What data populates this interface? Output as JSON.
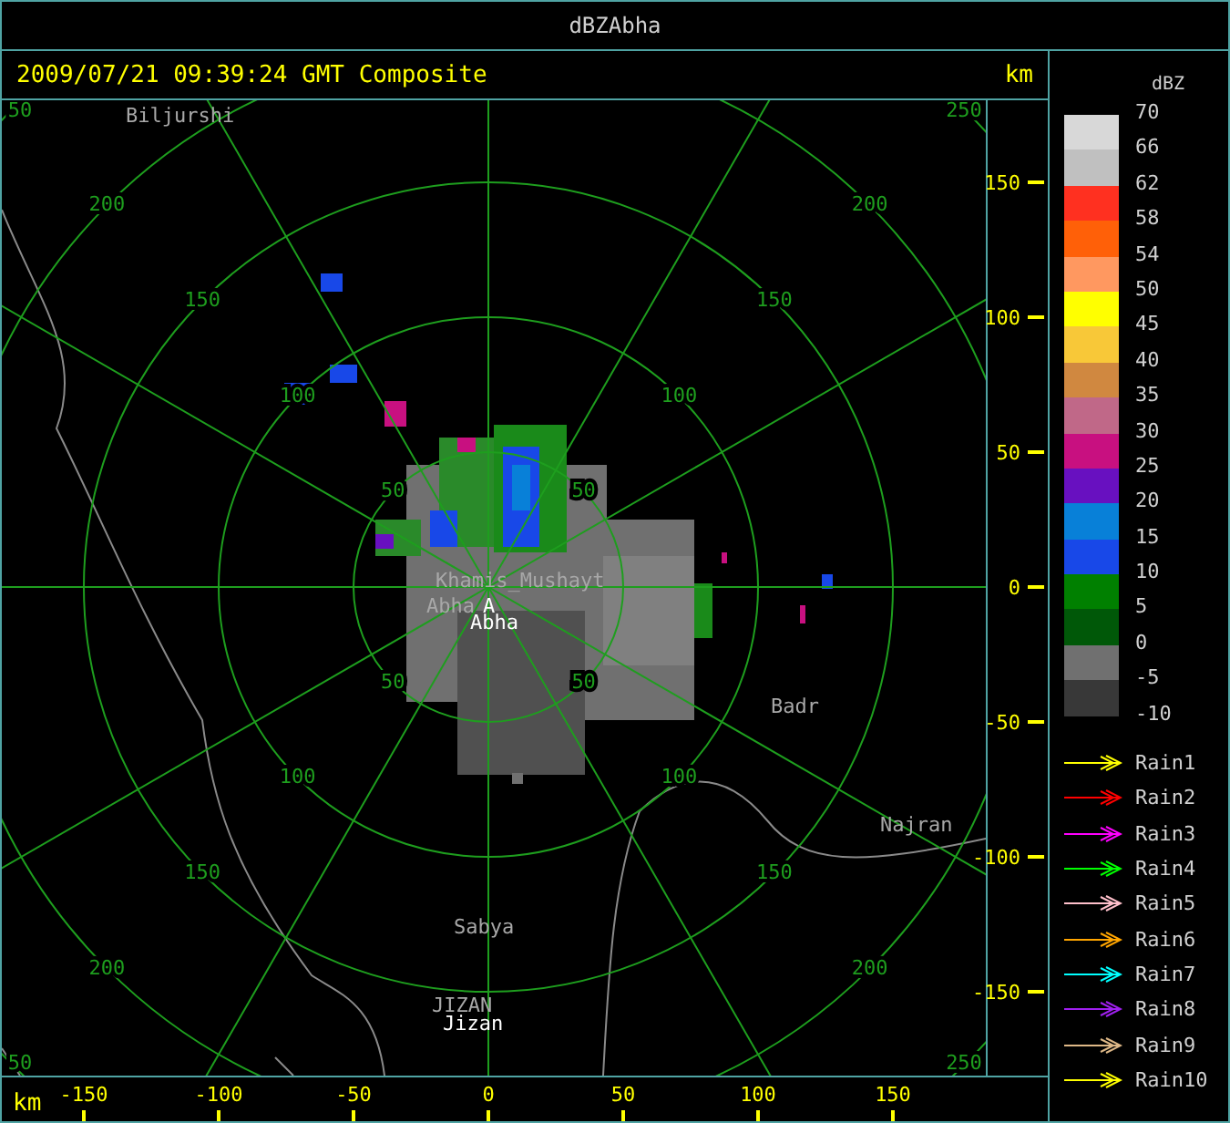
{
  "window": {
    "title": "dBZAbha"
  },
  "header": {
    "timestamp": "2009/07/21 09:39:24 GMT Composite",
    "unit": "km"
  },
  "map": {
    "rings": [
      {
        "labels": [
          "50",
          "50",
          "50",
          "50"
        ]
      },
      {
        "labels": [
          "100",
          "100",
          "100",
          "100"
        ]
      },
      {
        "labels": [
          "150",
          "150",
          "150",
          "150"
        ]
      },
      {
        "labels": [
          "200",
          "200",
          "200",
          "200"
        ]
      },
      {
        "labels": [
          "50",
          "250",
          "50",
          "250"
        ]
      }
    ],
    "places": [
      {
        "name": "Biljurshi",
        "kind": "town"
      },
      {
        "name": "Khamis_Mushayt",
        "kind": "town"
      },
      {
        "name": "Abha",
        "kind": "town"
      },
      {
        "name": "A",
        "kind": "radar"
      },
      {
        "name": "Abha",
        "kind": "radar"
      },
      {
        "name": "Badr",
        "kind": "town"
      },
      {
        "name": "Najran",
        "kind": "town"
      },
      {
        "name": "Sabya",
        "kind": "town"
      },
      {
        "name": "JIZAN",
        "kind": "town"
      },
      {
        "name": "Jizan",
        "kind": "radar"
      }
    ]
  },
  "y_axis": {
    "ticks": [
      "150",
      "100",
      "50",
      "0",
      "-50",
      "-100",
      "-150"
    ]
  },
  "x_axis": {
    "unit": "km",
    "ticks": [
      "-150",
      "-100",
      "-50",
      "0",
      "50",
      "100",
      "150"
    ]
  },
  "legend": {
    "title": "dBZ",
    "labels": [
      "70",
      "66",
      "62",
      "58",
      "54",
      "50",
      "45",
      "40",
      "35",
      "30",
      "25",
      "20",
      "15",
      "10",
      "5",
      "0",
      "-5",
      "-10"
    ],
    "bins": [
      {
        "color": "#d8d8d8"
      },
      {
        "color": "#c0c0c0"
      },
      {
        "color": "#ff3020"
      },
      {
        "color": "#ff6008"
      },
      {
        "color": "#ff9860"
      },
      {
        "color": "#ffff00"
      },
      {
        "color": "#f8c838"
      },
      {
        "color": "#d08840"
      },
      {
        "color": "#c06888"
      },
      {
        "color": "#c81080"
      },
      {
        "color": "#6810c0"
      },
      {
        "color": "#0880d8"
      },
      {
        "color": "#1848e8"
      },
      {
        "color": "#008000"
      },
      {
        "color": "#005808"
      },
      {
        "color": "#707070"
      },
      {
        "color": "#383838"
      }
    ],
    "tracks": [
      {
        "label": "Rain1",
        "color": "#ffff00"
      },
      {
        "label": "Rain2",
        "color": "#ff0000"
      },
      {
        "label": "Rain3",
        "color": "#ff00ff"
      },
      {
        "label": "Rain4",
        "color": "#00ff00"
      },
      {
        "label": "Rain5",
        "color": "#ffc0cb"
      },
      {
        "label": "Rain6",
        "color": "#ffa500"
      },
      {
        "label": "Rain7",
        "color": "#00ffff"
      },
      {
        "label": "Rain8",
        "color": "#a020f0"
      },
      {
        "label": "Rain9",
        "color": "#deb887"
      },
      {
        "label": "Rain10",
        "color": "#ffff00"
      }
    ]
  }
}
